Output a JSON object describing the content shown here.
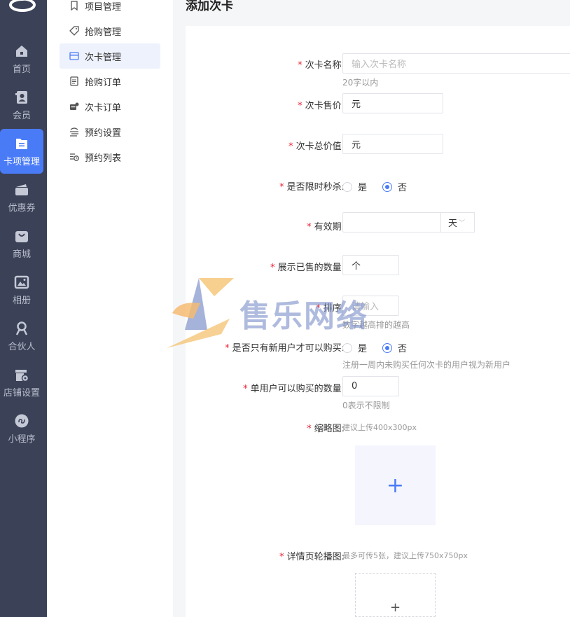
{
  "rail": {
    "items": [
      {
        "label": "首页",
        "icon": "home-icon"
      },
      {
        "label": "会员",
        "icon": "member-icon"
      },
      {
        "label": "卡项管理",
        "icon": "card-manage-icon",
        "active": true
      },
      {
        "label": "优惠券",
        "icon": "coupon-icon"
      },
      {
        "label": "商城",
        "icon": "mall-icon"
      },
      {
        "label": "相册",
        "icon": "album-icon"
      },
      {
        "label": "合伙人",
        "icon": "partner-icon"
      },
      {
        "label": "店铺设置",
        "icon": "shop-settings-icon"
      },
      {
        "label": "小程序",
        "icon": "miniprogram-icon"
      }
    ]
  },
  "submenu": {
    "items": [
      {
        "label": "项目管理",
        "icon": "bookmark-icon"
      },
      {
        "label": "抢购管理",
        "icon": "tag-icon"
      },
      {
        "label": "次卡管理",
        "icon": "card-icon",
        "active": true
      },
      {
        "label": "抢购订单",
        "icon": "order-list-icon"
      },
      {
        "label": "次卡订单",
        "icon": "card-order-icon"
      },
      {
        "label": "预约设置",
        "icon": "reservation-settings-icon"
      },
      {
        "label": "预约列表",
        "icon": "reservation-list-icon"
      }
    ]
  },
  "page": {
    "title": "添加次卡"
  },
  "form": {
    "name_label": "次卡名称:",
    "name_placeholder": "输入次卡名称",
    "name_hint": "20字以内",
    "price_label": "次卡售价:",
    "price_unit": "元",
    "total_label": "次卡总价值:",
    "total_unit": "元",
    "flash_label": "是否限时秒杀:",
    "yes": "是",
    "no": "否",
    "validity_label": "有效期:",
    "validity_unit": "天",
    "sold_label": "展示已售的数量:",
    "sold_unit": "个",
    "sort_label": "排序:",
    "sort_placeholder": "请输入",
    "sort_hint": "数字越高排的越高",
    "newuser_label": "是否只有新用户才可以购买:",
    "newuser_hint": "注册一周内未购买任何次卡的用户视为新用户",
    "limit_label": "单用户可以购买的数量:",
    "limit_value": "0",
    "limit_hint": "0表示不限制",
    "thumb_label": "缩略图:",
    "thumb_hint": "建议上传400x300px",
    "carousel_label": "详情页轮播图:",
    "carousel_hint": "最多可传5张，建议上传750x750px",
    "plus": "+"
  },
  "watermark": {
    "text": "售乐网络"
  },
  "colors": {
    "accent": "#4a7bf7",
    "rail_bg": "#3b4258",
    "required": "#ee2233"
  }
}
